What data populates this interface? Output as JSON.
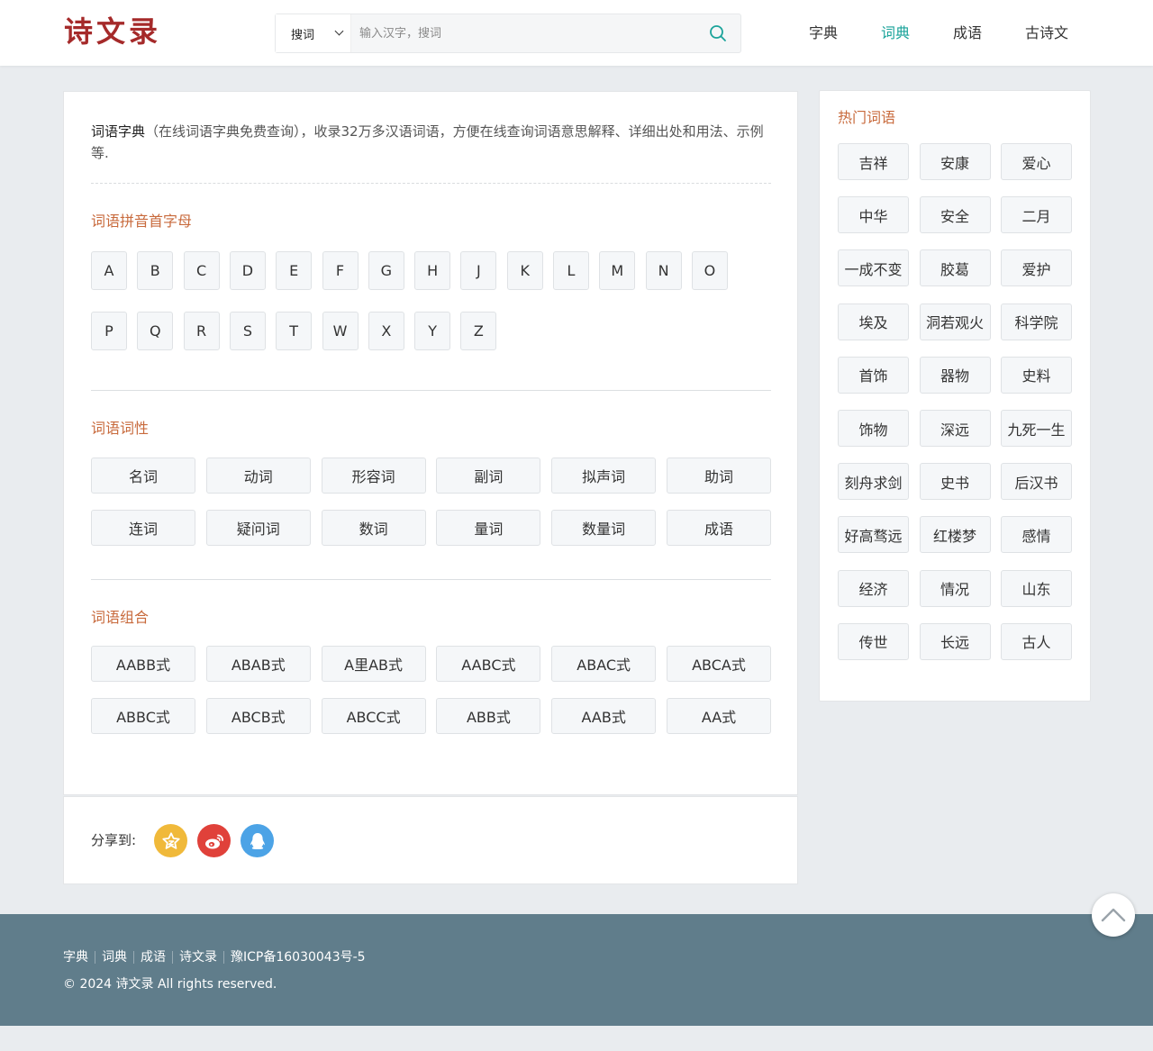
{
  "header": {
    "logo": "诗文录",
    "search": {
      "type_label": "搜词",
      "placeholder": "输入汉字，搜词"
    },
    "nav": [
      "字典",
      "词典",
      "成语",
      "古诗文"
    ],
    "active_nav": "词典"
  },
  "intro": {
    "lead": "词语字典",
    "text": "（在线词语字典免费查询），收录32万多汉语词语，方便在线查询词语意思解释、详细出处和用法、示例等."
  },
  "pinyin": {
    "title": "词语拼音首字母",
    "letters": [
      "A",
      "B",
      "C",
      "D",
      "E",
      "F",
      "G",
      "H",
      "J",
      "K",
      "L",
      "M",
      "N",
      "O",
      "P",
      "Q",
      "R",
      "S",
      "T",
      "W",
      "X",
      "Y",
      "Z"
    ]
  },
  "pos": {
    "title": "词语词性",
    "items": [
      "名词",
      "动词",
      "形容词",
      "副词",
      "拟声词",
      "助词",
      "连词",
      "疑问词",
      "数词",
      "量词",
      "数量词",
      "成语"
    ]
  },
  "combo": {
    "title": "词语组合",
    "items": [
      "AABB式",
      "ABAB式",
      "A里AB式",
      "AABC式",
      "ABAC式",
      "ABCA式",
      "ABBC式",
      "ABCB式",
      "ABCC式",
      "ABB式",
      "AAB式",
      "AA式"
    ]
  },
  "share": {
    "label": "分享到:"
  },
  "sidebar": {
    "title": "热门词语",
    "words": [
      "吉祥",
      "安康",
      "爱心",
      "中华",
      "安全",
      "二月",
      "一成不变",
      "胶葛",
      "爱护",
      "埃及",
      "洞若观火",
      "科学院",
      "首饰",
      "器物",
      "史料",
      "饰物",
      "深远",
      "九死一生",
      "刻舟求剑",
      "史书",
      "后汉书",
      "好高骛远",
      "红楼梦",
      "感情",
      "经济",
      "情况",
      "山东",
      "传世",
      "长远",
      "古人"
    ]
  },
  "footer": {
    "links": [
      "字典",
      "词典",
      "成语",
      "诗文录",
      "豫ICP备16030043号-5"
    ],
    "copyright": "© 2024 诗文录 All rights reserved."
  },
  "colors": {
    "accent": "#1aa39a",
    "section": "#c86a3c",
    "logo": "#a52a2a",
    "footer": "#607d8b"
  }
}
